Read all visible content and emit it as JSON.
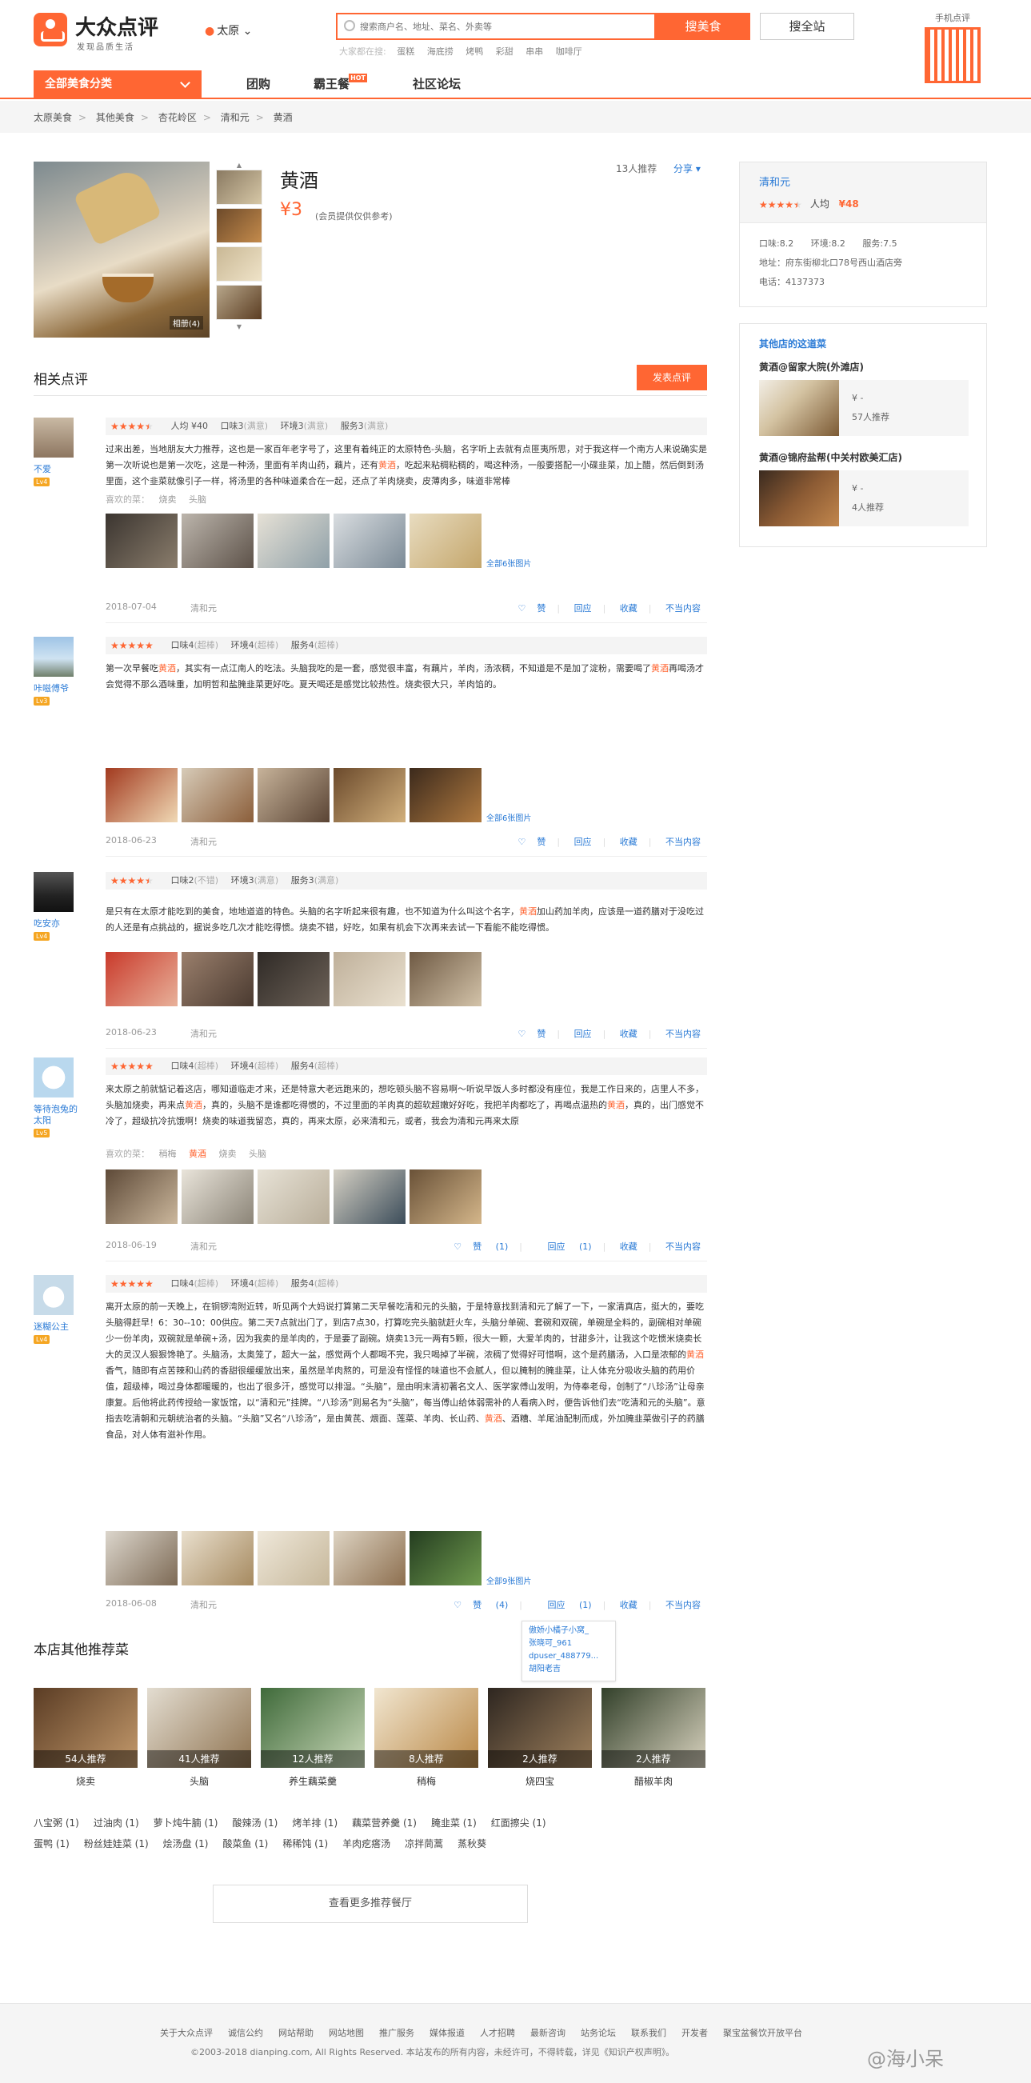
{
  "header": {
    "logo_name": "大众点评",
    "logo_slogan": "发现品质生活",
    "city": "太原",
    "search_placeholder": "搜索商户名、地址、菜名、外卖等",
    "search_button": "搜美食",
    "search_all_button": "搜全站",
    "hot_label": "大家都在搜:",
    "hot_words": [
      "蛋糕",
      "海底捞",
      "烤鸭",
      "彩甜",
      "串串",
      "咖啡厅"
    ],
    "qr_label": "手机点评"
  },
  "nav": {
    "category": "全部美食分类",
    "items": [
      "团购",
      "霸王餐",
      "社区论坛"
    ],
    "hot_badge": "HOT"
  },
  "breadcrumb": [
    "太原美食",
    "其他美食",
    "杏花岭区",
    "清和元",
    "黄酒"
  ],
  "dish": {
    "title": "黄酒",
    "price": "¥3",
    "price_note": "(会员提供仅供参考)",
    "recommend_count": "13人推荐",
    "share": "分享",
    "photo_caption": "相册(4)"
  },
  "shop": {
    "name": "清和元",
    "rating": 4,
    "avg_label": "人均",
    "avg": "¥48",
    "scores": [
      "口味:8.2",
      "环境:8.2",
      "服务:7.5"
    ],
    "address": "地址：府东街柳北口78号西山酒店旁",
    "phone": "电话：4137373"
  },
  "other_shops": {
    "title": "其他店的这道菜",
    "items": [
      {
        "name": "黄酒@留家大院(外滩店)",
        "price": "¥ -",
        "count": "57人推荐"
      },
      {
        "name": "黄酒@锦府盐帮(中关村欧美汇店)",
        "price": "¥ -",
        "count": "4人推荐"
      }
    ]
  },
  "reviews_section": {
    "title": "相关点评",
    "write_button": "发表点评",
    "all_photos_prefix": "全部",
    "actions": [
      "赞",
      "回应",
      "收藏",
      "不当内容"
    ],
    "dish_label": "喜欢的菜："
  },
  "reviews": [
    {
      "user": "不爱",
      "level": "Lv4",
      "rating": 4,
      "avg": "人均 ¥40",
      "scores": [
        {
          "t": "口味3",
          "g": "(满意)"
        },
        {
          "t": "环境3",
          "g": "(满意)"
        },
        {
          "t": "服务3",
          "g": "(满意)"
        }
      ],
      "text": "过来出差，当地朋友大力推荐，这也是一家百年老字号了，这里有着纯正的太原特色-头脑，名字听上去就有点匪夷所思，对于我这样一个南方人来说确实是第一次听说也是第一次吃，这是一种汤，里面有羊肉山药，藕片，还有黄酒，吃起来粘稠粘稠的，喝这种汤，一般要搭配一小碟韭菜，加上醋，然后倒到汤里面，这个韭菜就像引子一样，将汤里的各种味道柔合在一起，还点了羊肉烧卖，皮薄肉多，味道非常棒",
      "dishes": [
        "烧卖",
        "头脑"
      ],
      "photo_count": "6",
      "date": "2018-07-04",
      "shop": "清和元",
      "likes": ""
    },
    {
      "user": "咔嗞傅爷",
      "level": "Lv3",
      "rating": 5,
      "avg": "",
      "scores": [
        {
          "t": "口味4",
          "g": "(超棒)"
        },
        {
          "t": "环境4",
          "g": "(超棒)"
        },
        {
          "t": "服务4",
          "g": "(超棒)"
        }
      ],
      "text": "第一次早餐吃黄酒，其实有一点江南人的吃法。头脑我吃的是一套，感觉很丰富，有藕片，羊肉，汤浓稠，不知道是不是加了淀粉，需要喝了黄酒再喝汤才会觉得不那么酒味重，加明哲和盐腌韭菜更好吃。夏天喝还是感觉比较热性。烧卖很大只，羊肉馅的。",
      "dishes": [],
      "photo_count": "6",
      "date": "2018-06-23",
      "shop": "清和元",
      "likes": ""
    },
    {
      "user": "吃安亦",
      "level": "Lv4",
      "rating": 4,
      "avg": "",
      "scores": [
        {
          "t": "口味2",
          "g": "(不错)"
        },
        {
          "t": "环境3",
          "g": "(满意)"
        },
        {
          "t": "服务3",
          "g": "(满意)"
        }
      ],
      "text": "是只有在太原才能吃到的美食，地地道道的特色。头脑的名字听起来很有趣，也不知道为什么叫这个名字，黄酒加山药加羊肉，应该是一道药膳对于没吃过的人还是有点挑战的，据说多吃几次才能吃得惯。烧卖不错，好吃，如果有机会下次再来去试一下看能不能吃得惯。",
      "dishes": [],
      "photo_count": "",
      "date": "2018-06-23",
      "shop": "清和元",
      "likes": ""
    },
    {
      "user": "等待泡兔的太阳",
      "level": "Lv5",
      "rating": 5,
      "avg": "",
      "scores": [
        {
          "t": "口味4",
          "g": "(超棒)"
        },
        {
          "t": "环境4",
          "g": "(超棒)"
        },
        {
          "t": "服务4",
          "g": "(超棒)"
        }
      ],
      "text": "来太原之前就惦记着这店，哪知道临走才来，还是特意大老远跑来的，想吃顿头脑不容易啊～听说早饭人多时都没有座位，我是工作日来的，店里人不多，头脑加烧卖，再来点黄酒，真的，头脑不是谁都吃得惯的，不过里面的羊肉真的超软超嫩好好吃，我把羊肉都吃了，再喝点温热的黄酒，真的，出门感觉不冷了，超级抗冷抗饿啊！烧卖的味道我留恋，真的，再来太原，必来清和元，或者，我会为清和元再来太原",
      "dishes": [
        "稍梅",
        "黄酒",
        "烧卖",
        "头脑"
      ],
      "photo_count": "",
      "date": "2018-06-19",
      "shop": "清和元",
      "likes": "(1)",
      "reply": "(1)"
    },
    {
      "user": "迷糊公主",
      "level": "Lv4",
      "rating": 5,
      "avg": "",
      "scores": [
        {
          "t": "口味4",
          "g": "(超棒)"
        },
        {
          "t": "环境4",
          "g": "(超棒)"
        },
        {
          "t": "服务4",
          "g": "(超棒)"
        }
      ],
      "text": "离开太原的前一天晚上，在铜锣湾附近转，听见两个大妈说打算第二天早餐吃清和元的头脑，于是特意找到清和元了解了一下，一家清真店，挺大的，要吃头脑得赶早！6：30--10：00供应。第二天7点就出门了，到店7点30，打算吃完头脑就赶火车，头脑分单碗、套碗和双碗，单碗是全料的，副碗相对单碗少一份羊肉，双碗就是单碗+汤，因为我卖的是羊肉的，于是要了副碗。烧卖13元一两有5颗，很大一颗，大爱羊肉的，甘甜多汁，让我这个吃惯米烧卖长大的灵汉人狠狠馋艳了。头脑汤，太奥笼了，超大一盆，感觉两个人都喝不完，我只喝掉了半碗，浓稠了觉得好可惜啊，这个是药膳汤，入口是浓郁的黄酒香气，随即有点苦辣和山药的香甜很缓缓放出来，虽然是羊肉熬的，可是没有怪怪的味道也不会腻人，但以腌制的腌韭菜，让人体充分吸收头脑的药用价值，超级棒，喝过身体都暖暖的，也出了很多汗，感觉可以排湿。“头脑”，是由明末清初著名文人、医学家傅山发明，为侍奉老母，创制了“八珍汤”让母亲康复。后他将此药传授给一家饭馆，以“清和元”挂牌。“八珍汤”则易名为“头脑”，每当傅山给体弱需补的人看病入时，便告诉他们去“吃清和元的头脑”。意指去吃清朝和元朝统治者的头脑。“头脑”又名“八珍汤”，是由黄芪、煨面、莲菜、羊肉、长山药、黄酒、酒糟、羊尾油配制而成，外加腌韭菜做引子的药膳食品，对人体有滋补作用。",
      "dishes": [],
      "photo_count": "9",
      "date": "2018-06-08",
      "shop": "清和元",
      "likes": "(4)",
      "reply": "(1)"
    }
  ],
  "like_tip": [
    "傲娇小橘子小窝_",
    "张晓可_961",
    "dpuser_488779...",
    "胡阳老吉"
  ],
  "other_dishes": {
    "title": "本店其他推荐菜",
    "items": [
      {
        "name": "烧卖",
        "count": "54人推荐"
      },
      {
        "name": "头脑",
        "count": "41人推荐"
      },
      {
        "name": "养生藕菜羹",
        "count": "12人推荐"
      },
      {
        "name": "稍梅",
        "count": "8人推荐"
      },
      {
        "name": "烧四宝",
        "count": "2人推荐"
      },
      {
        "name": "醋椒羊肉",
        "count": "2人推荐"
      }
    ],
    "tags_row1": [
      "八宝粥 (1)",
      "过油肉 (1)",
      "萝卜炖牛腩 (1)",
      "酸辣汤 (1)",
      "烤羊排 (1)",
      "藕菜营养羹 (1)",
      "腌韭菜 (1)",
      "红面擦尖 (1)"
    ],
    "tags_row2": [
      "蛋鸭 (1)",
      "粉丝娃娃菜 (1)",
      "烩汤盘 (1)",
      "酸菜鱼 (1)",
      "稀稀饨 (1)",
      "羊肉疙瘩汤",
      "凉拌茼蒿",
      "蒸秋葵"
    ],
    "more_button": "查看更多推荐餐厅"
  },
  "footer": {
    "links": [
      "关于大众点评",
      "诚信公约",
      "网站帮助",
      "网站地图",
      "推广服务",
      "媒体报道",
      "人才招聘",
      "最新咨询",
      "站务论坛",
      "联系我们",
      "开发者",
      "聚宝盆餐饮开放平台"
    ],
    "copyright": "©2003-2018 dianping.com, All Rights Reserved.    本站发布的所有内容，未经许可，不得转载，详见《知识产权声明》。",
    "watermark": "@海小呆"
  }
}
